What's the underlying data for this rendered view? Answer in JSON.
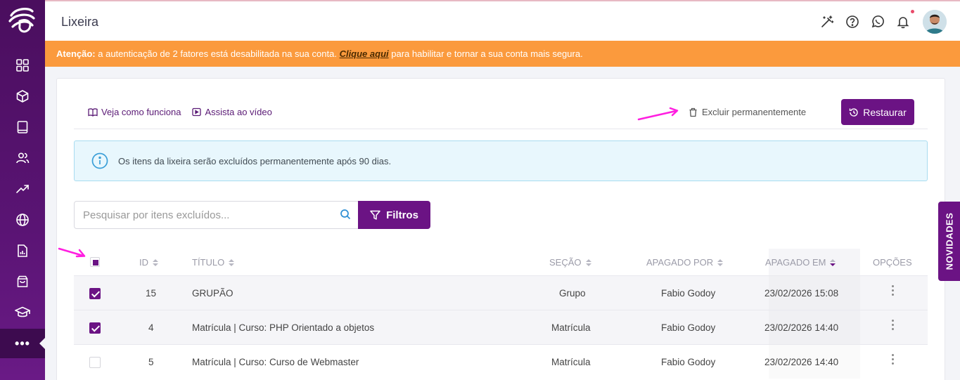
{
  "header": {
    "title": "Lixeira"
  },
  "alert": {
    "label": "Atenção:",
    "text": "a autenticação de 2 fatores está desabilitada na sua conta.",
    "link": "Clique aqui",
    "suffix": "para habilitar e tornar a sua conta mais segura."
  },
  "toolbar": {
    "how_it_works": "Veja como funciona",
    "watch_video": "Assista ao vídeo",
    "delete_permanently": "Excluir permanentemente",
    "restore": "Restaurar"
  },
  "info": {
    "text": "Os itens da lixeira serão excluídos permanentemente após 90 dias."
  },
  "search": {
    "placeholder": "Pesquisar por itens excluídos...",
    "filters": "Filtros"
  },
  "table": {
    "headers": {
      "id": "ID",
      "title": "TÍTULO",
      "section": "SEÇÃO",
      "deleted_by": "APAGADO POR",
      "deleted_at": "APAGADO EM",
      "options": "OPÇÕES"
    },
    "rows": [
      {
        "id": "15",
        "title": "GRUPÃO",
        "section": "Grupo",
        "deleted_by": "Fabio Godoy",
        "deleted_at": "23/02/2026 15:08",
        "checked": true
      },
      {
        "id": "4",
        "title": "Matrícula | Curso: PHP Orientado a objetos",
        "section": "Matrícula",
        "deleted_by": "Fabio Godoy",
        "deleted_at": "23/02/2026 14:40",
        "checked": true
      },
      {
        "id": "5",
        "title": "Matrícula | Curso: Curso de Webmaster",
        "section": "Matrícula",
        "deleted_by": "Fabio Godoy",
        "deleted_at": "23/02/2026 14:40",
        "checked": false
      }
    ]
  },
  "side_tab": {
    "label": "NOVIDADES"
  },
  "colors": {
    "primary": "#6b1384",
    "alert": "#fb9a3d",
    "sidebar": "#4a0e5e",
    "info_bg": "#e8f7fd",
    "annotation_arrow": "#ff1ee0"
  },
  "icons": [
    "grid-icon",
    "cube-icon",
    "book-icon",
    "users-icon",
    "trend-icon",
    "globe-icon",
    "report-icon",
    "bag-icon",
    "graduation-icon",
    "more-icon",
    "magic-wand-icon",
    "help-icon",
    "whatsapp-icon",
    "bell-icon",
    "search-icon",
    "filter-icon",
    "trash-icon",
    "restore-icon",
    "info-icon"
  ]
}
